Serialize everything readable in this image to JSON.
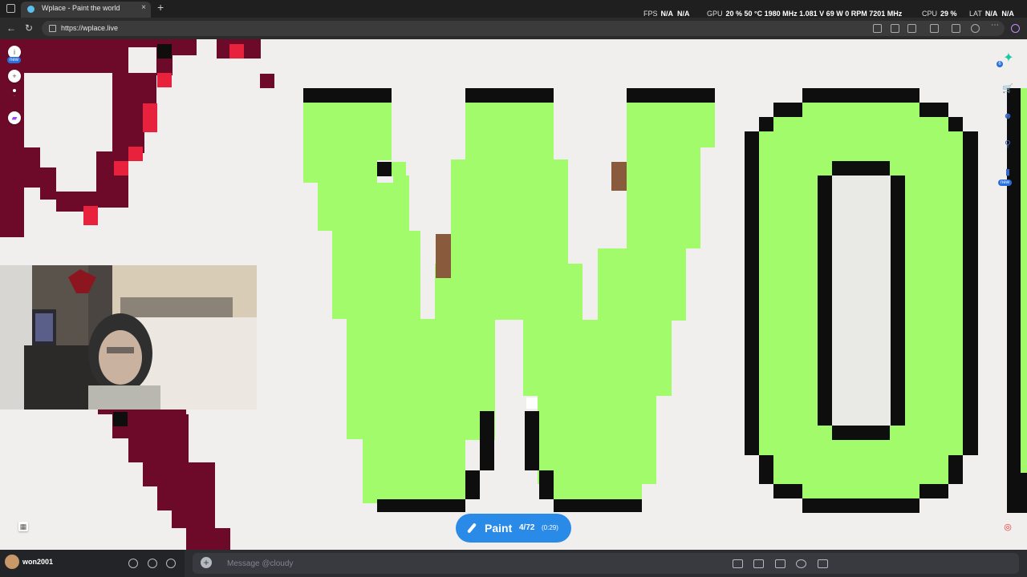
{
  "browser": {
    "tab_title": "Wplace - Paint the world",
    "new_tab_symbol": "+",
    "close_symbol": "×",
    "url": "https://wplace.live"
  },
  "overlay": {
    "fps_label": "FPS",
    "fps_value": "N/A",
    "fps_value2": "N/A",
    "gpu_label": "GPU",
    "gpu_value": "20 % 50 °C 1980 MHz 1.081 V 69 W 0 RPM 7201 MHz",
    "cpu_label": "CPU",
    "cpu_value": "29 %",
    "lat_label": "LAT",
    "lat_value": "N/A",
    "lat_value2": "N/A"
  },
  "canvas": {
    "colors": {
      "green": "#a2fb6b",
      "black": "#0e0e0e",
      "maroon": "#6e0a29",
      "red": "#e8213d",
      "brown": "#8a5a3c",
      "bg": "#f0efee"
    }
  },
  "left_controls": {
    "info": "i",
    "zoom_in": "+",
    "zoom_out": "-"
  },
  "badges": {
    "new": "new",
    "count": "6"
  },
  "paint_button": {
    "label": "Paint",
    "count": "4/72",
    "timer": "(0:29)"
  },
  "discord": {
    "username": "won2001",
    "message_placeholder": "Message @cloudy"
  }
}
